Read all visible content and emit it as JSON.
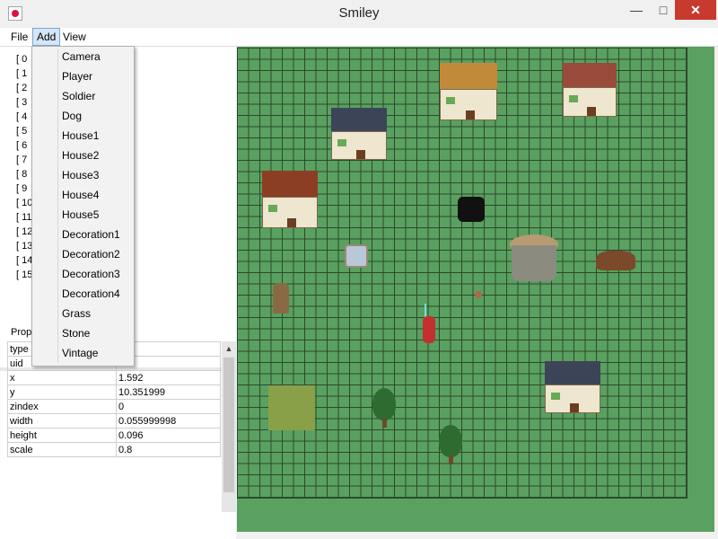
{
  "window": {
    "title": "Smiley",
    "minimize": "—",
    "maximize": "□",
    "close": "✕"
  },
  "menubar": {
    "file": "File",
    "add": "Add",
    "view": "View"
  },
  "tree": {
    "items": [
      "[ 0",
      "[ 1",
      "[ 2",
      "[ 3",
      "[ 4",
      "[ 5",
      "[ 6",
      "[ 7",
      "[ 8",
      "[ 9",
      "[ 10",
      "[ 11",
      "[ 12",
      "[ 13",
      "[ 14",
      "[ 15"
    ]
  },
  "add_menu": {
    "items": [
      "Camera",
      "Player",
      "Soldier",
      "Dog",
      "House1",
      "House2",
      "House3",
      "House4",
      "House5",
      "Decoration1",
      "Decoration2",
      "Decoration3",
      "Decoration4",
      "Grass",
      "Stone",
      "Vintage"
    ]
  },
  "properties": {
    "header_property": "Prop",
    "header_value": "ue",
    "rows": [
      {
        "key": "type",
        "value": "lier"
      },
      {
        "key": "uid",
        "value": ""
      },
      {
        "key": "x",
        "value": "1.592"
      },
      {
        "key": "y",
        "value": "10.351999"
      },
      {
        "key": "zindex",
        "value": "0"
      },
      {
        "key": "width",
        "value": "0.055999998"
      },
      {
        "key": "height",
        "value": "0.096"
      },
      {
        "key": "scale",
        "value": "0.8"
      }
    ]
  },
  "icons": {
    "app": "java-icon",
    "scroll_up": "scroll-up-arrow-icon"
  },
  "colors": {
    "canvas_bg": "#5aa060",
    "grid_line": "#2a4a2c",
    "close_button": "#c8392e",
    "menu_highlight": "#d6e6f7"
  }
}
